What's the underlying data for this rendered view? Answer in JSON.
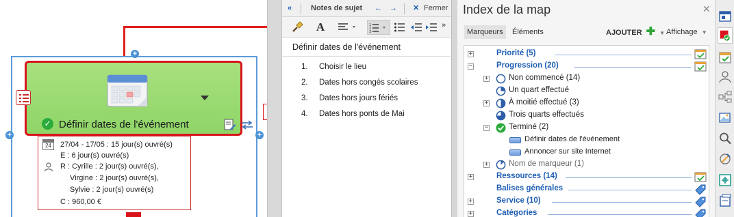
{
  "topic": {
    "title": "Définir dates de l'événement",
    "details": {
      "dates_line": "27/04 - 17/05 : 15 jour(s) ouvré(s)",
      "effort_line": "E : 6 jour(s) ouvré(s)",
      "resources": [
        "R : Cyrille : 2 jour(s) ouvré(s),",
        "Virgine : 2 jour(s) ouvré(s),",
        "Sylvie : 2 jour(s) ouvré(s)"
      ],
      "cost_line": "C : 960,00 €",
      "calendar_icon_number": "24"
    }
  },
  "notes": {
    "header_title": "Notes de sujet",
    "close_label": "Fermer",
    "title": "Définir dates de l'événement",
    "items": [
      {
        "num": "1.",
        "text": "Choisir le lieu"
      },
      {
        "num": "2.",
        "text": "Dates hors congés scolaires"
      },
      {
        "num": "3.",
        "text": "Dates hors jours fériés"
      },
      {
        "num": "4.",
        "text": "Dates hors ponts de Mai"
      }
    ]
  },
  "index": {
    "title": "Index de la map",
    "tabs": {
      "markers": "Marqueurs",
      "elements": "Éléments"
    },
    "add_label": "AJOUTER",
    "view_label": "Affichage",
    "tree": {
      "priorite": "Priorité (5)",
      "progression": "Progression (20)",
      "non_commence": "Non commencé (14)",
      "quart": "Un quart effectué",
      "moitie": "À moitié effectué (3)",
      "trois_quarts": "Trois quarts effectués",
      "termine": "Terminé (2)",
      "task1": "Définir dates de l'événement",
      "task2": "Annoncer sur site Internet",
      "nom_marqueur": "Nom de marqueur (1)",
      "ressources": "Ressources (14)",
      "balises": "Balises générales",
      "service": "Service (10)",
      "categories": "Catégories"
    }
  },
  "colors": {
    "accent_blue": "#1f5fb5",
    "topic_fill": "#9ad86f",
    "topic_border": "#d9141b",
    "complete_green": "#2bab3a"
  }
}
